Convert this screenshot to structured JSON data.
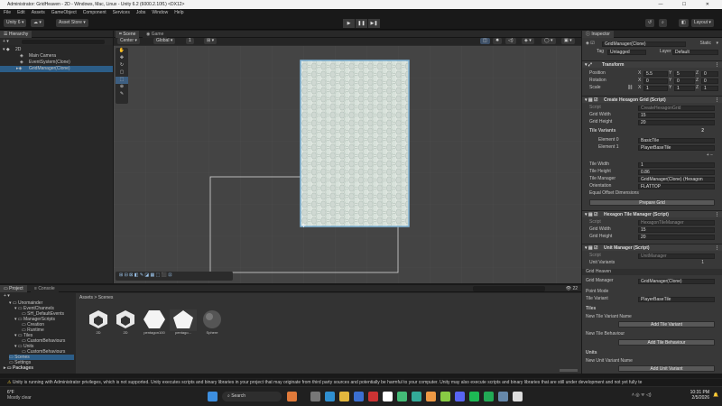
{
  "window": {
    "title": "Administrator: GridHeaven - 2D - Windows, Mac, Linux - Unity 6.2 (6000.2.10f1) <DX12>"
  },
  "menu": [
    "File",
    "Edit",
    "Assets",
    "GameObject",
    "Component",
    "Services",
    "Jobs",
    "Window",
    "Help"
  ],
  "toolbar": {
    "account": "Unity 6",
    "asset_store": "Asset Store",
    "layout": "Layout"
  },
  "hierarchy": {
    "tab": "Hierarchy",
    "scene": "2D",
    "items": [
      "Main Camera",
      "EventSystem(Clone)",
      "GridManager(Clone)"
    ]
  },
  "scene": {
    "tab_scene": "Scene",
    "tab_game": "Game",
    "pivot": "Center",
    "space": "Global",
    "snap": "1"
  },
  "inspector": {
    "tab": "Inspector",
    "object_name": "GridManager(Clone)",
    "static_label": "Static",
    "tag_label": "Tag",
    "tag": "Untagged",
    "layer_label": "Layer",
    "layer": "Default",
    "transform": {
      "header": "Transform",
      "position_label": "Position",
      "rotation_label": "Rotation",
      "scale_label": "Scale",
      "position": [
        "5.5",
        "5",
        "0"
      ],
      "rotation": [
        "0",
        "0",
        "0"
      ],
      "scale": [
        "1",
        "1",
        "1"
      ]
    },
    "create_grid": {
      "header": "Create Hexagon Grid (Script)",
      "script_label": "Script",
      "script": "CreateHexagonGrid",
      "width_label": "Grid Width",
      "width": "15",
      "height_label": "Grid Height",
      "height": "20",
      "variants_label": "Tile Variants",
      "variants_count": "2",
      "element0_label": "Element 0",
      "element0": "BasicTile",
      "element1_label": "Element 1",
      "element1": "PlayerBaseTile",
      "tile_width_label": "Tile Width",
      "tile_width": "1",
      "tile_height_label": "Tile Height",
      "tile_height": "0.86",
      "tile_manager_label": "Tile Manager",
      "tile_manager": "GridManager(Clone) (Hexagon",
      "orientation_label": "Orientation",
      "orientation": "FLATTOP",
      "equal_offset_label": "Equal Offset Dimensions",
      "prepare_button": "Prepare Grid"
    },
    "tile_manager": {
      "header": "Hexagon Tile Manager (Script)",
      "script_label": "Script",
      "script": "HexagonTileManager",
      "width_label": "Grid Width",
      "width": "15",
      "height_label": "Grid Height",
      "height": "20"
    },
    "unit_manager": {
      "header": "Unit Manager (Script)",
      "script_label": "Script",
      "script": "UnitManager",
      "variants_label": "Unit Variants",
      "variants_count": "1",
      "heaven_label": "Grid Heaven",
      "grid_manager_label": "Grid Manager",
      "grid_manager": "GridManager(Clone)",
      "point_mode_label": "Point Mode",
      "tile_variant_label": "Tile Variant",
      "tile_variant": "PlayerBaseTile",
      "tiles_label": "Tiles",
      "new_tile_variant_label": "New Tile Variant Name",
      "add_tile_variant": "Add Tile Variant",
      "new_tile_behaviour_label": "New Tile Behaviour",
      "add_tile_behaviour": "Add Tile Behaviour",
      "units_label": "Units",
      "new_unit_variant_label": "New Unit Variant Name",
      "add_unit_variant": "Add Unit Variant"
    }
  },
  "project": {
    "tab_project": "Project",
    "tab_console": "Console",
    "breadcrumb_root": "Assets",
    "breadcrumb_sep": ">",
    "breadcrumb_leaf": "Scenes",
    "count": "22",
    "tree": [
      "Unomainder",
      "EventChannels",
      "SH_DefaultEvents",
      "ManagerScripts",
      "Creation",
      "Runtime",
      "Tiles",
      "CustomBehaviours",
      "Units",
      "CustomBehaviours",
      "Scenes",
      "Settings",
      "Packages"
    ],
    "assets": [
      "2D",
      "2D",
      "pentagon100",
      "pentago...",
      "Sphere"
    ]
  },
  "status": {
    "message": "Unity is running with Administrator privileges, which is not supported. Unity executes scripts and binary libraries in your project that may originate from third party sources and potentially be harmful to your computer. Unity may also execute scripts and binary libraries that are still under development and not yet fully te"
  },
  "taskbar": {
    "weather_temp": "6°F",
    "weather_desc": "Mostly clear",
    "search": "Search",
    "time": "10:31 PM",
    "date": "2/5/2026"
  }
}
